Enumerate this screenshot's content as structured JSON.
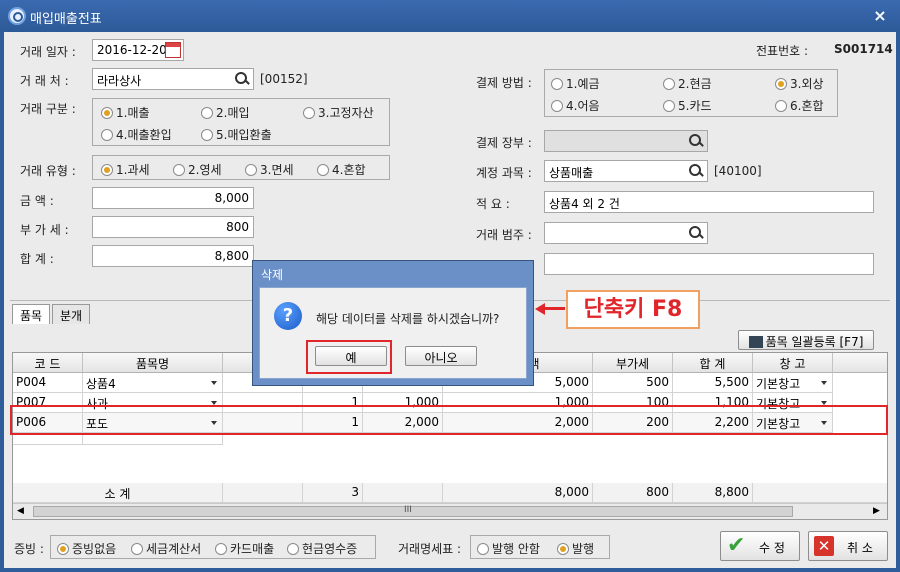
{
  "window": {
    "title": "매입매출전표",
    "close": "×"
  },
  "header": {
    "date_label": "거래 일자 :",
    "date_value": "2016-12-20",
    "voucher_label": "전표번호 :",
    "voucher_value": "S001714"
  },
  "form_left": {
    "client_label": "거 래 처 :",
    "client_value": "라라상사",
    "client_code": "[00152]",
    "trade_type_label": "거래 구분 :",
    "trade_types": [
      "1.매출",
      "2.매입",
      "3.고정자산",
      "4.매출환입",
      "5.매입환출"
    ],
    "trade_type_selected": 0,
    "tax_type_label": "거래 유형 :",
    "tax_types": [
      "1.과세",
      "2.영세",
      "3.면세",
      "4.혼합"
    ],
    "tax_type_selected": 0,
    "amount_label": "금 액 :",
    "amount_value": "8,000",
    "vat_label": "부 가 세 :",
    "vat_value": "800",
    "total_label": "합 계 :",
    "total_value": "8,800"
  },
  "form_right": {
    "payment_label": "결제 방법 :",
    "payments": [
      "1.예금",
      "2.현금",
      "3.외상",
      "4.어음",
      "5.카드",
      "6.혼합"
    ],
    "payment_selected": 2,
    "ledger_label": "결제 장부 :",
    "ledger_value": "",
    "account_label": "계정 과목 :",
    "account_value": "상품매출",
    "account_code": "[40100]",
    "summary_label": "적 요 :",
    "summary_value": "상품4 외 2 건",
    "category_label": "거래 범주 :",
    "category_value": "",
    "extra_value": ""
  },
  "tabs": [
    "품목",
    "분개"
  ],
  "bulk_button": "품목 일괄등록 [F7]",
  "grid": {
    "headers": [
      "코 드",
      "품목명",
      "규",
      "",
      "",
      "공급가액",
      "부가세",
      "합 계",
      "창 고"
    ],
    "rows": [
      {
        "code": "P004",
        "name": "상품4",
        "qty": "",
        "price": "",
        "supply": "5,000",
        "vat": "500",
        "total": "5,500",
        "wh": "기본창고"
      },
      {
        "code": "P007",
        "name": "사과",
        "qty": "1",
        "price": "1,000",
        "supply": "1,000",
        "vat": "100",
        "total": "1,100",
        "wh": "기본창고"
      },
      {
        "code": "P006",
        "name": "포도",
        "qty": "1",
        "price": "2,000",
        "supply": "2,000",
        "vat": "200",
        "total": "2,200",
        "wh": "기본창고"
      }
    ],
    "subtotal": {
      "label": "소 계",
      "qty": "3",
      "supply": "8,000",
      "vat": "800",
      "total": "8,800"
    },
    "scroll_grip": "III"
  },
  "footer": {
    "evidence_label": "증빙 :",
    "evidence": [
      "증빙없음",
      "세금계산서",
      "카드매출",
      "현금영수증"
    ],
    "evidence_selected": 0,
    "statement_label": "거래명세표 :",
    "statement": [
      "발행 안함",
      "발행"
    ],
    "statement_selected": 1,
    "edit_button": "수 정",
    "cancel_button": "취 소"
  },
  "dialog": {
    "title": "삭제",
    "message": "해당 데이터를 삭제를 하시겠습니까?",
    "yes": "예",
    "no": "아니오"
  },
  "annotation": {
    "callout": "단축키 F8",
    "accent": "#e0262a"
  }
}
